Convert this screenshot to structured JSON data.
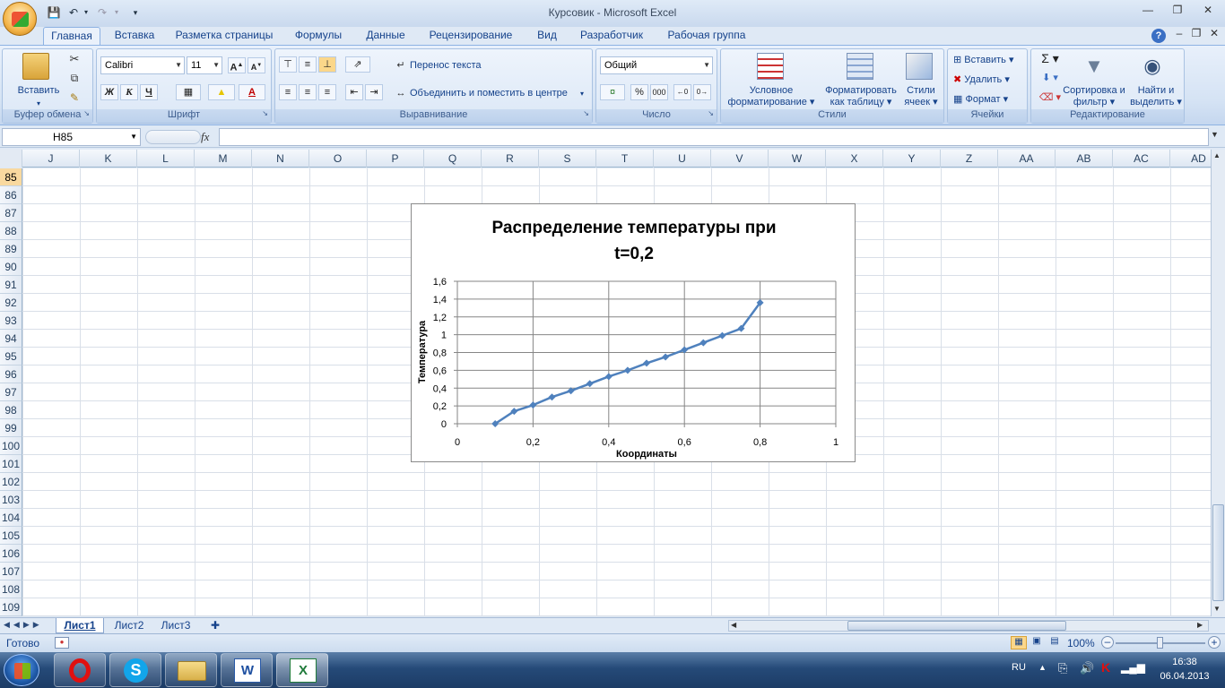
{
  "window": {
    "title": "Курсовик - Microsoft Excel"
  },
  "ribbon": {
    "tabs": [
      "Главная",
      "Вставка",
      "Разметка страницы",
      "Формулы",
      "Данные",
      "Рецензирование",
      "Вид",
      "Разработчик",
      "Рабочая группа"
    ],
    "clipboard": {
      "paste": "Вставить",
      "label": "Буфер обмена"
    },
    "font": {
      "name": "Calibri",
      "size": "11",
      "label": "Шрифт",
      "bold": "Ж",
      "italic": "К",
      "underline": "Ч"
    },
    "alignment": {
      "wrap": "Перенос текста",
      "merge": "Объединить и поместить в центре",
      "label": "Выравнивание"
    },
    "number": {
      "format": "Общий",
      "percent": "%",
      "thousands": "000",
      "label": "Число"
    },
    "styles": {
      "conditional": "Условное форматирование",
      "table": "Форматировать как таблицу",
      "cell": "Стили ячеек",
      "label": "Стили"
    },
    "cells": {
      "insert": "Вставить",
      "delete": "Удалить",
      "format": "Формат",
      "label": "Ячейки"
    },
    "editing": {
      "sort": "Сортировка и фильтр",
      "find": "Найти и выделить",
      "label": "Редактирование"
    }
  },
  "formula_bar": {
    "name_box": "H85",
    "fx": "fx",
    "value": ""
  },
  "columns": [
    "J",
    "K",
    "L",
    "M",
    "N",
    "O",
    "P",
    "Q",
    "R",
    "S",
    "T",
    "U",
    "V",
    "W",
    "X",
    "Y",
    "Z",
    "AA",
    "AB",
    "AC",
    "AD"
  ],
  "rows": [
    "85",
    "86",
    "87",
    "88",
    "89",
    "90",
    "91",
    "92",
    "93",
    "94",
    "95",
    "96",
    "97",
    "98",
    "99",
    "100",
    "101",
    "102",
    "103",
    "104",
    "105",
    "106",
    "107",
    "108",
    "109"
  ],
  "chart_data": {
    "type": "line",
    "title": "Распределение температуры при t=0,2",
    "title_line1": "Распределение температуры при",
    "title_line2": "t=0,2",
    "xlabel": "Координаты",
    "ylabel": "Температура",
    "xlim": [
      0,
      1
    ],
    "ylim": [
      0,
      1.6
    ],
    "x_ticks": [
      "0",
      "0,2",
      "0,4",
      "0,6",
      "0,8",
      "1"
    ],
    "y_ticks": [
      "0",
      "0,2",
      "0,4",
      "0,6",
      "0,8",
      "1",
      "1,2",
      "1,4",
      "1,6"
    ],
    "grid": true,
    "series": [
      {
        "color": "#4f81bd",
        "x": [
          0.1,
          0.15,
          0.2,
          0.25,
          0.3,
          0.35,
          0.4,
          0.45,
          0.5,
          0.55,
          0.6,
          0.65,
          0.7,
          0.75,
          0.8
        ],
        "y": [
          0.0,
          0.14,
          0.21,
          0.3,
          0.37,
          0.45,
          0.53,
          0.6,
          0.68,
          0.75,
          0.83,
          0.91,
          0.99,
          1.07,
          1.36
        ]
      }
    ]
  },
  "sheets": [
    "Лист1",
    "Лист2",
    "Лист3"
  ],
  "status": {
    "ready": "Готово",
    "zoom": "100%"
  },
  "taskbar": {
    "lang": "RU",
    "time": "16:38",
    "date": "06.04.2013"
  }
}
